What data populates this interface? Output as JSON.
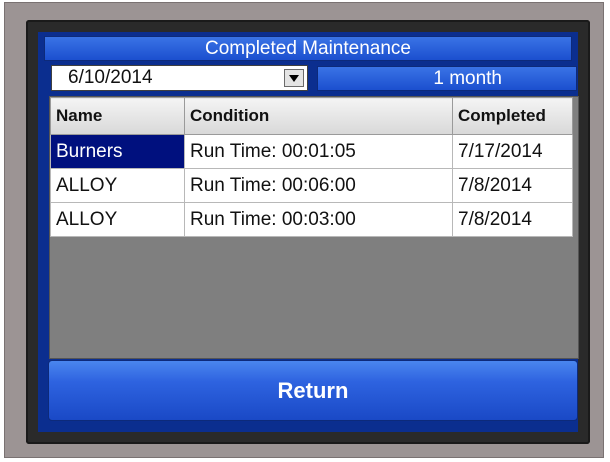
{
  "screen": {
    "title": "Completed Maintenance",
    "date_filter": {
      "value": "6/10/2014",
      "dropdown_icon": "triangle-down-icon"
    },
    "range_button_label": "1 month",
    "table": {
      "columns": [
        "Name",
        "Condition",
        "Completed"
      ],
      "rows": [
        {
          "name": "Burners",
          "condition": "Run Time: 00:01:05",
          "completed": "7/17/2014"
        },
        {
          "name": "ALLOY",
          "condition": "Run Time: 00:06:00",
          "completed": "7/8/2014"
        },
        {
          "name": "ALLOY",
          "condition": "Run Time: 00:03:00",
          "completed": "7/8/2014"
        }
      ],
      "selected_row": 0
    },
    "return_label": "Return"
  },
  "colors": {
    "button_blue": "#1b4fcf",
    "selection_navy": "#00107e",
    "bezel_gray": "#9c9494",
    "grid_empty": "#7f7f7f"
  }
}
